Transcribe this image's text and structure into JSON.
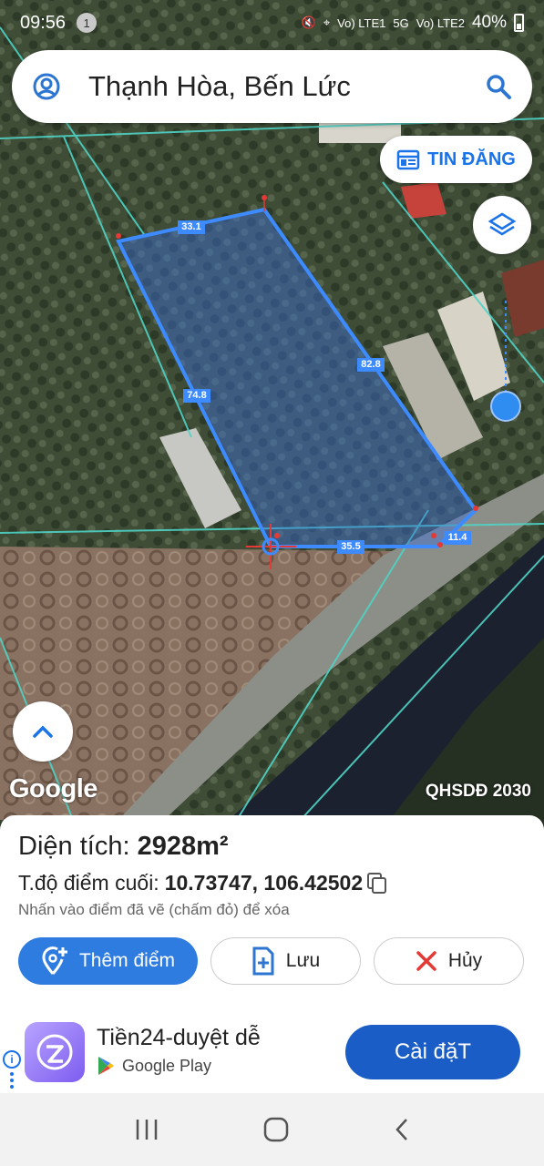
{
  "status_bar": {
    "time": "09:56",
    "notification_count": "1",
    "network1": "Vo) LTE1",
    "network_5g": "5G",
    "network2": "Vo) LTE2",
    "battery": "40%"
  },
  "search": {
    "location": "Thạnh Hòa, Bến Lức",
    "icons": {
      "left": "account-icon",
      "right": "search-icon"
    }
  },
  "map": {
    "tin_dang_label": "TIN ĐĂNG",
    "edge_labels": [
      "33.1",
      "82.8",
      "74.8",
      "35.5",
      "11.4"
    ],
    "watermark": "Google",
    "layer_label": "QHSDĐ 2030",
    "colors": {
      "polygon_fill": "#3b6fd9",
      "polygon_stroke": "#3d8bff",
      "parcel_lines": "#4fd3c4",
      "point": "#e53935"
    }
  },
  "panel": {
    "area_label": "Diện tích:",
    "area_value": "2928m²",
    "coord_label": "T.độ điểm cuối:",
    "coord_value": "10.73747, 106.42502",
    "hint": "Nhấn vào điểm đã vẽ (chấm đỏ) để xóa",
    "buttons": {
      "add_point": "Thêm điểm",
      "save": "Lưu",
      "cancel": "Hủy"
    }
  },
  "ad": {
    "app_name": "Tiền24-duyệt dễ",
    "store": "Google Play",
    "install_label": "Cài đặT"
  }
}
